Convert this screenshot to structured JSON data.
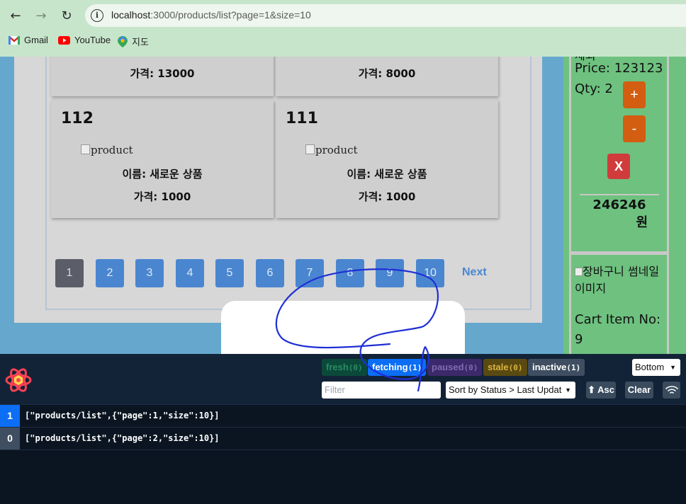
{
  "browser": {
    "url_host": "localhost",
    "url_rest": ":3000/products/list?page=1&size=10",
    "bookmarks": [
      {
        "label": "Gmail"
      },
      {
        "label": "YouTube"
      },
      {
        "label": "지도"
      }
    ]
  },
  "products": {
    "top_cards": [
      {
        "price": "가격: 13000"
      },
      {
        "price": "가격: 8000"
      }
    ],
    "cards": [
      {
        "id": "112",
        "image_alt": "product",
        "name": "이름: 새로운 상품",
        "price": "가격: 1000"
      },
      {
        "id": "111",
        "image_alt": "product",
        "name": "이름: 새로운 상품",
        "price": "가격: 1000"
      }
    ]
  },
  "pagination": {
    "pages": [
      "1",
      "2",
      "3",
      "4",
      "5",
      "6",
      "7",
      "8",
      "9",
      "10"
    ],
    "current": "1",
    "next_label": "Next"
  },
  "cart": {
    "item1": {
      "partial_name": "제외",
      "price": "Price: 123123",
      "qty": "Qty: 2",
      "plus_label": "+",
      "minus_label": "-",
      "delete_label": "X",
      "total": "246246",
      "total_unit": "원"
    },
    "item2": {
      "thumb_alt": "장바구니 썸네일 이미지",
      "item_no_label": "Cart Item No:",
      "item_no": "9"
    }
  },
  "devtools": {
    "status_chips": [
      {
        "label": "fresh",
        "count": "(0)"
      },
      {
        "label": "fetching",
        "count": "(1)"
      },
      {
        "label": "paused",
        "count": "(0)"
      },
      {
        "label": "stale",
        "count": "(0)"
      },
      {
        "label": "inactive",
        "count": "(1)"
      }
    ],
    "position_select": "Bottom",
    "filter_placeholder": "Filter",
    "sort_select": "Sort by Status > Last Updat",
    "asc_label": "⬆ Asc",
    "clear_label": "Clear",
    "queries": [
      {
        "count": "1",
        "key": "[\"products/list\",{\"page\":1,\"size\":10}]"
      },
      {
        "count": "0",
        "key": "[\"products/list\",{\"page\":2,\"size\":10}]"
      }
    ]
  },
  "colors": {
    "fetching": "#0b6ef5",
    "inactive_count": "#3f4e60",
    "page_bg": "#66a8cd",
    "cart_bg": "#6ec17f"
  }
}
